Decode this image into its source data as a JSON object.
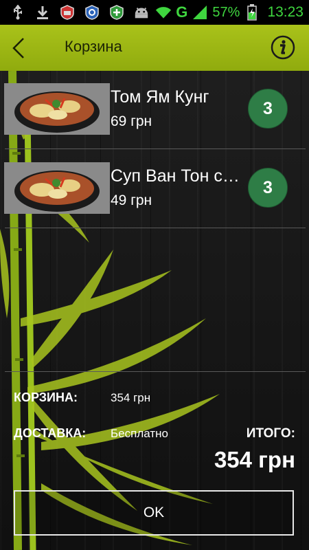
{
  "status_bar": {
    "network": "G",
    "battery_percent": "57%",
    "time": "13:23",
    "icons": [
      "usb-icon",
      "download-icon",
      "app-badge-icon",
      "shield-icon",
      "shield-plus-icon",
      "android-icon",
      "wifi-icon",
      "signal-icon",
      "battery-icon"
    ]
  },
  "app_bar": {
    "title": "Корзина",
    "accent_color": "#9ab513"
  },
  "cart": {
    "items": [
      {
        "name": "Том Ям Кунг",
        "price": "69 грн",
        "quantity": "3"
      },
      {
        "name": "Суп Ван Тон с…",
        "price": "49 грн",
        "quantity": "3"
      }
    ]
  },
  "summary": {
    "cart_label": "КОРЗИНА:",
    "cart_value": "354 грн",
    "delivery_label": "ДОСТАВКА:",
    "delivery_value": "Бесплатно",
    "total_label": "ИТОГО:",
    "total_value": "354 грн"
  },
  "ok_label": "OK"
}
